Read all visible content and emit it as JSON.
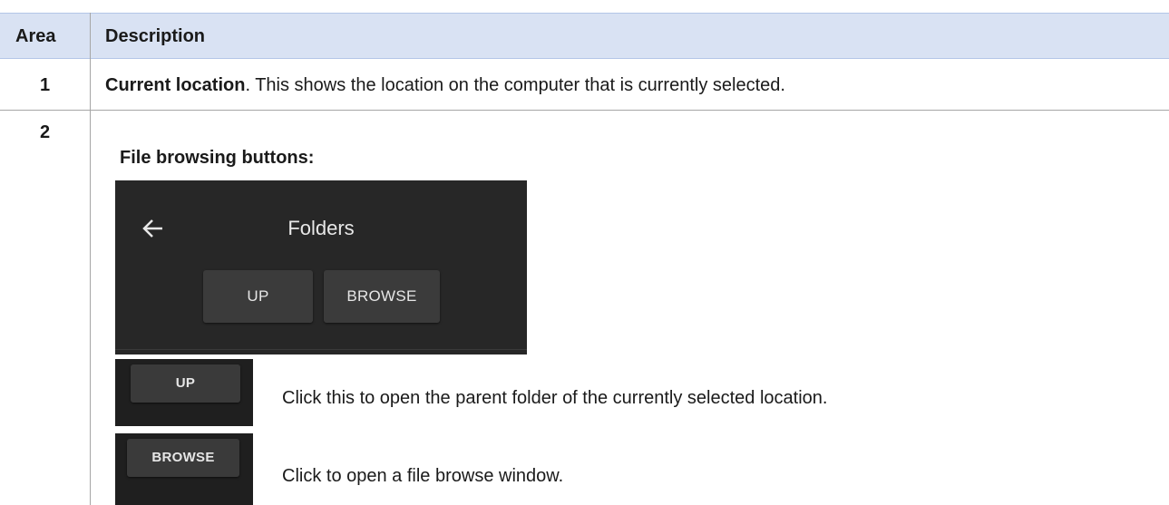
{
  "table": {
    "headers": {
      "area": "Area",
      "description": "Description"
    },
    "row1": {
      "number": "1",
      "bold_text": "Current location",
      "rest_text": ". This shows the location on the computer that is currently selected."
    },
    "row2": {
      "number": "2",
      "heading": "File browsing buttons:",
      "panel": {
        "title": "Folders",
        "back_icon": "arrow-left-icon",
        "up_label": "UP",
        "browse_label": "BROWSE"
      },
      "items": [
        {
          "button_label": "UP",
          "text": "Click this to open the parent folder of the currently selected location."
        },
        {
          "button_label": "BROWSE",
          "text": "Click to open a file browse window."
        }
      ]
    }
  },
  "colors": {
    "header_bg": "#d9e2f3",
    "panel_bg": "#272727",
    "button_bg": "#3b3b3b"
  }
}
